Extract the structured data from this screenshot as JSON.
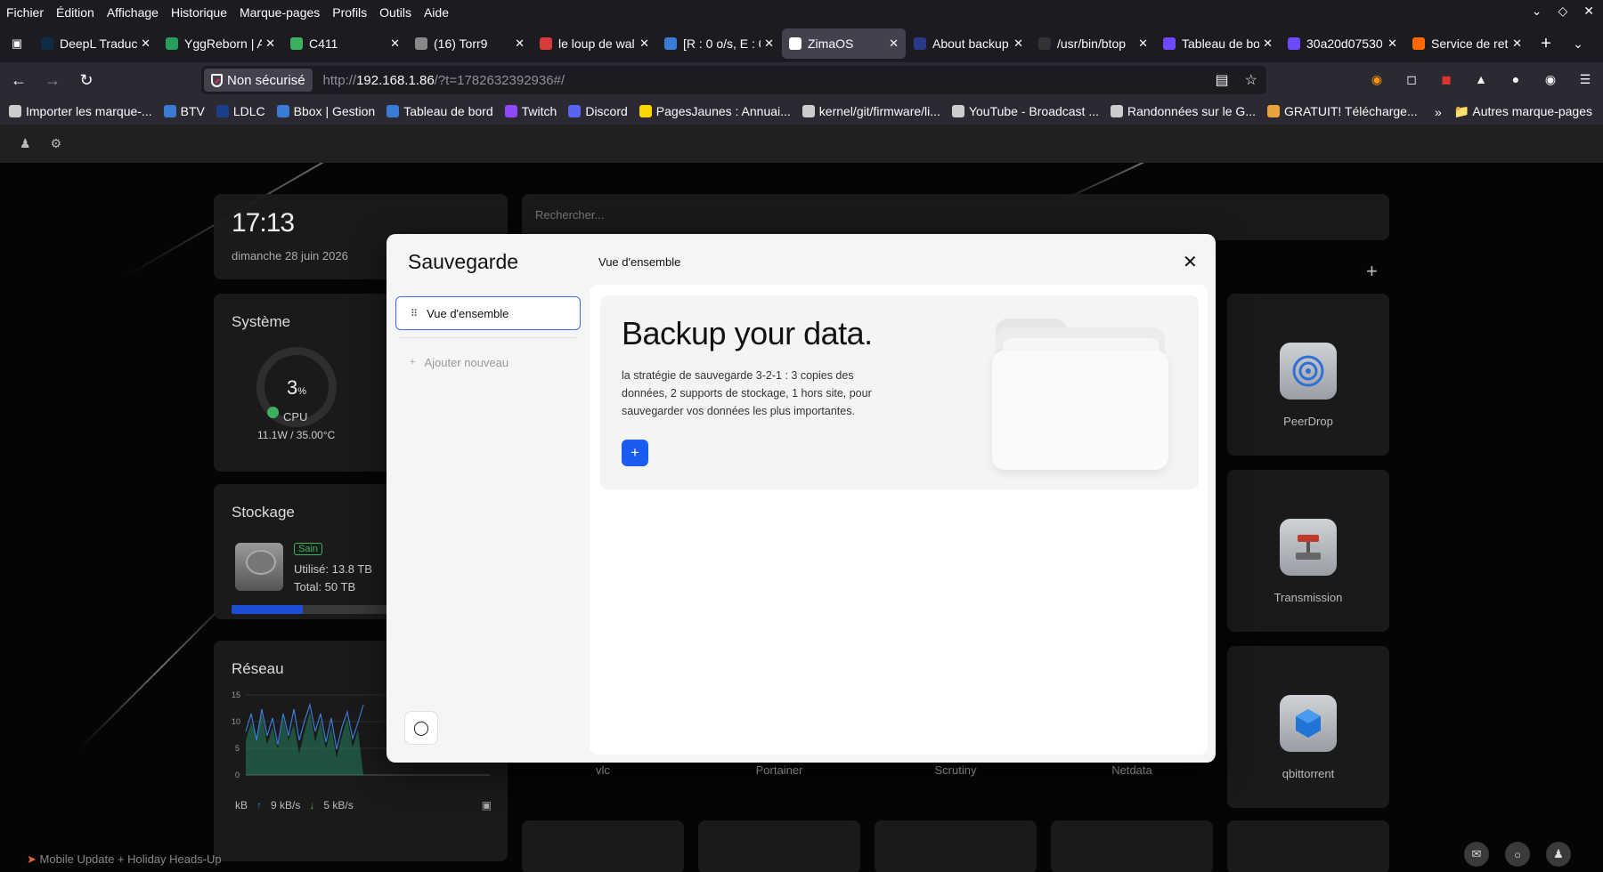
{
  "menubar": {
    "items": [
      "Fichier",
      "Édition",
      "Affichage",
      "Historique",
      "Marque-pages",
      "Profils",
      "Outils",
      "Aide"
    ]
  },
  "tabs": [
    {
      "label": "DeepL Traduc",
      "icon": "deepl-icon",
      "color": "#0f2b46",
      "active": false
    },
    {
      "label": "YggReborn | A",
      "icon": "ygg-icon",
      "color": "#2a9d5a",
      "active": false
    },
    {
      "label": "C411",
      "icon": "c411-icon",
      "color": "#3bb15d",
      "active": false
    },
    {
      "label": "(16) Torr9",
      "icon": "torr9-icon",
      "color": "#888888",
      "active": false
    },
    {
      "label": "le loup de wal",
      "icon": "loup-icon",
      "color": "#d93a3a",
      "active": false
    },
    {
      "label": "[R : 0 o/s, E : 0",
      "icon": "qbit-icon",
      "color": "#3a7bd5",
      "active": false
    },
    {
      "label": "ZimaOS",
      "icon": "zima-icon",
      "color": "#ffffff",
      "active": true
    },
    {
      "label": "About backup",
      "icon": "backup-icon",
      "color": "#2a3a8a",
      "active": false
    },
    {
      "label": "/usr/bin/btop",
      "icon": "terminal-icon",
      "color": "#333333",
      "active": false
    },
    {
      "label": "Tableau de bo",
      "icon": "proton-icon",
      "color": "#6d4aff",
      "active": false
    },
    {
      "label": "30a20d07530",
      "icon": "proton-icon",
      "color": "#6d4aff",
      "active": false
    },
    {
      "label": "Service de ret",
      "icon": "service-icon",
      "color": "#ff6a00",
      "active": false
    }
  ],
  "navbar": {
    "secure_label": "Non sécurisé",
    "url_prefix": "http://",
    "url_host": "192.168.1.86",
    "url_path": "/?t=1782632392936#/"
  },
  "bookmarks": [
    {
      "label": "Importer les marque-...",
      "icon": "import-icon",
      "color": "#cccccc"
    },
    {
      "label": "BTV",
      "icon": "btv-icon",
      "color": "#3a7bd5"
    },
    {
      "label": "LDLC",
      "icon": "ldlc-icon",
      "color": "#1a3f8a"
    },
    {
      "label": "Bbox | Gestion",
      "icon": "bbox-icon",
      "color": "#3a7bd5"
    },
    {
      "label": "Tableau de bord",
      "icon": "dashboard-icon",
      "color": "#3a7bd5"
    },
    {
      "label": "Twitch",
      "icon": "twitch-icon",
      "color": "#9146ff"
    },
    {
      "label": "Discord",
      "icon": "discord-icon",
      "color": "#5865f2"
    },
    {
      "label": "PagesJaunes : Annuai...",
      "icon": "pagesjaunes-icon",
      "color": "#ffd700"
    },
    {
      "label": "kernel/git/firmware/li...",
      "icon": "globe-icon",
      "color": "#cccccc"
    },
    {
      "label": "YouTube - Broadcast ...",
      "icon": "globe-icon",
      "color": "#cccccc"
    },
    {
      "label": "Randonnées sur le G...",
      "icon": "globe-icon",
      "color": "#cccccc"
    },
    {
      "label": "GRATUIT! Télécharge...",
      "icon": "gratuit-icon",
      "color": "#e8a33a"
    }
  ],
  "bookmarks_other": "Autres marque-pages",
  "dashboard": {
    "time": "17:13",
    "date": "dimanche 28 juin 2026",
    "system": {
      "title": "Système",
      "cpu_value": "3",
      "cpu_unit": "%",
      "cpu_label": "CPU",
      "power_temp": "11.1W / 35.00°C"
    },
    "storage": {
      "title": "Stockage",
      "status": "Sain",
      "used": "Utilisé: 13.8 TB",
      "total": "Total: 50 TB",
      "used_fraction": 0.276
    },
    "network": {
      "title": "Réseau",
      "y_ticks": [
        "15",
        "10",
        "5",
        "0"
      ],
      "unit": "kB",
      "up": "9 kB/s",
      "down": "5 kB/s"
    },
    "search_placeholder": "Rechercher...",
    "apps_right": [
      "PeerDrop",
      "Transmission",
      "qbittorrent"
    ],
    "apps_bottom": [
      "vlc",
      "Portainer",
      "Scrutiny",
      "Netdata"
    ],
    "notice": "Mobile Update + Holiday Heads-Up"
  },
  "modal": {
    "title": "Sauvegarde",
    "heading": "Vue d'ensemble",
    "sidebar": {
      "overview": "Vue d'ensemble",
      "add_new": "Ajouter nouveau"
    },
    "hero": {
      "title": "Backup your data.",
      "description": "la stratégie de sauvegarde 3-2-1 : 3 copies des données, 2 supports de stockage, 1 hors site, pour sauvegarder vos données les plus importantes.",
      "add_symbol": "+"
    }
  }
}
